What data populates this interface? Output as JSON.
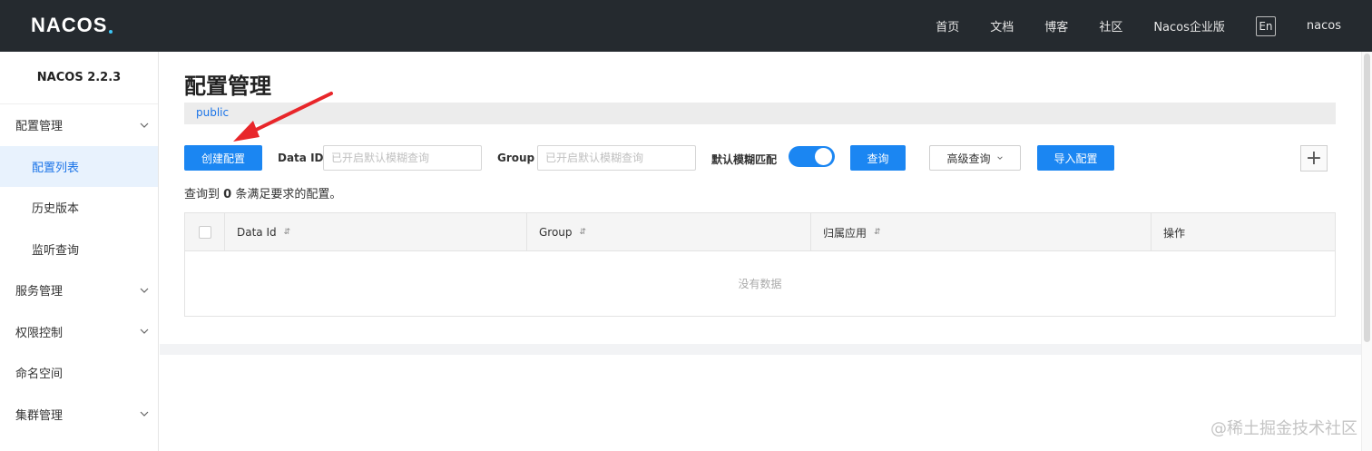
{
  "header": {
    "logo": "NACOS",
    "nav": [
      "首页",
      "文档",
      "博客",
      "社区",
      "Nacos企业版"
    ],
    "lang": "En",
    "user": "nacos"
  },
  "sidebar": {
    "version": "NACOS 2.2.3",
    "items": [
      {
        "label": "配置管理",
        "expandable": true
      },
      {
        "label": "配置列表",
        "sub": true,
        "active": true
      },
      {
        "label": "历史版本",
        "sub": true
      },
      {
        "label": "监听查询",
        "sub": true
      },
      {
        "label": "服务管理",
        "expandable": true
      },
      {
        "label": "权限控制",
        "expandable": true
      },
      {
        "label": "命名空间"
      },
      {
        "label": "集群管理",
        "expandable": true
      }
    ]
  },
  "main": {
    "title": "配置管理",
    "namespace": "public",
    "create_button": "创建配置",
    "data_id_label": "Data ID",
    "data_id_placeholder": "已开启默认模糊查询",
    "group_label": "Group",
    "group_placeholder": "已开启默认模糊查询",
    "fuzzy_label": "默认模糊匹配",
    "fuzzy_enabled": true,
    "query_button": "查询",
    "advanced_button": "高级查询",
    "import_button": "导入配置",
    "plus_button": "+",
    "summary_prefix": "查询到",
    "summary_count": "0",
    "summary_suffix": "条满足要求的配置。",
    "table": {
      "columns": [
        "Data Id",
        "Group",
        "归属应用",
        "操作"
      ],
      "empty": "没有数据"
    }
  },
  "watermark": "@稀土掘金技术社区",
  "colors": {
    "topbar": "#252a2f",
    "primary": "#1b86f2",
    "active_menu_bg": "#e8f2fd",
    "arrow": "#e8262a"
  }
}
